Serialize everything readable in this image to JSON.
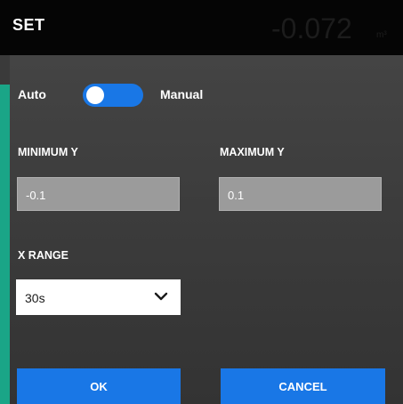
{
  "header": {
    "title": "SET",
    "reading": "-0.072",
    "unit": "m³"
  },
  "mode_toggle": {
    "left_label": "Auto",
    "right_label": "Manual",
    "state": "auto"
  },
  "min_y": {
    "label": "MINIMUM Y",
    "value": "-0.1"
  },
  "max_y": {
    "label": "MAXIMUM Y",
    "value": "0.1"
  },
  "x_range": {
    "label": "X RANGE",
    "selected": "30s"
  },
  "buttons": {
    "ok": "OK",
    "cancel": "CANCEL"
  },
  "colors": {
    "accent_blue": "#1977e6",
    "side_strip": "#1aa587",
    "field_gray": "#9b9b9b"
  }
}
